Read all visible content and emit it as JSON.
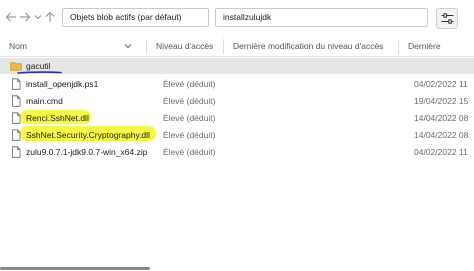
{
  "toolbar": {
    "filter_value": "Objets blob actifs (par défaut)",
    "search_value": "installzulujdk"
  },
  "columns": [
    "Nom",
    "Niveau d'accès",
    "Dernière modification du niveau d'accès",
    "Dernière"
  ],
  "rows": [
    {
      "name": "gacutil",
      "type": "folder",
      "access": "",
      "modified": "",
      "selected": true
    },
    {
      "name": "install_openjdk.ps1",
      "type": "file",
      "access": "Élevé (déduit)",
      "modified": "04/02/2022 11"
    },
    {
      "name": "main.cmd",
      "type": "file",
      "access": "Élevé (déduit)",
      "modified": "19/04/2022 15"
    },
    {
      "name": "Renci.SshNet.dll",
      "type": "file",
      "access": "Élevé (déduit)",
      "modified": "14/04/2022 08",
      "highlighted": true
    },
    {
      "name": "SshNet.Security.Cryptography.dll",
      "type": "file",
      "access": "Élevé (déduit)",
      "modified": "14/04/2022 08",
      "highlighted": true
    },
    {
      "name": "zulu9.0.7.1-jdk9.0.7-win_x64.zip",
      "type": "file",
      "access": "Élevé (déduit)",
      "modified": "04/02/2022 11"
    }
  ],
  "colors": {
    "highlight": "#f4f83a",
    "folder": "#e8b84a",
    "selection": "#e6e6e6",
    "underline": "#2a2fb0"
  },
  "icons": [
    "back-arrow-icon",
    "forward-arrow-icon",
    "chevron-down-icon",
    "up-arrow-icon",
    "filter-sliders-icon",
    "sort-chevron-icon",
    "folder-icon",
    "file-icon"
  ]
}
